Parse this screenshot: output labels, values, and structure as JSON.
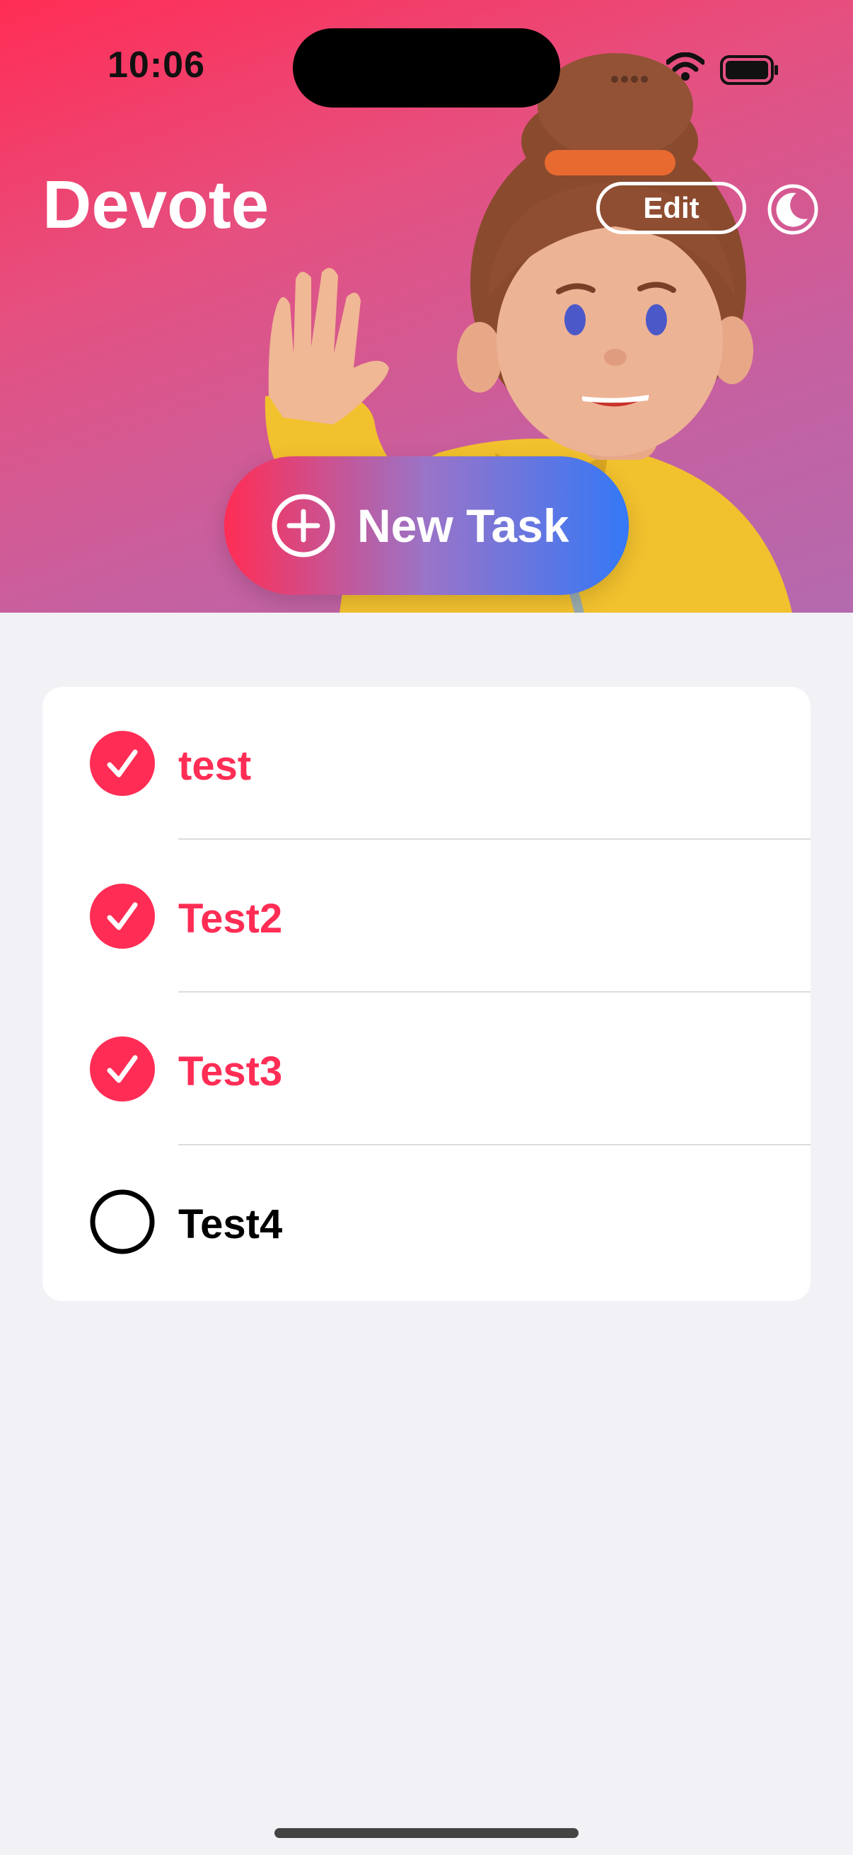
{
  "status": {
    "time": "10:06"
  },
  "header": {
    "title": "Devote",
    "edit_label": "Edit",
    "moon_icon": "moon-icon"
  },
  "new_task": {
    "label": "New Task"
  },
  "tasks": [
    {
      "label": "test",
      "done": true
    },
    {
      "label": "Test2",
      "done": true
    },
    {
      "label": "Test3",
      "done": true
    },
    {
      "label": "Test4",
      "done": false
    }
  ],
  "colors": {
    "accent": "#ff2d55",
    "gradient_end": "#3478f6",
    "background": "#f2f2f6"
  }
}
